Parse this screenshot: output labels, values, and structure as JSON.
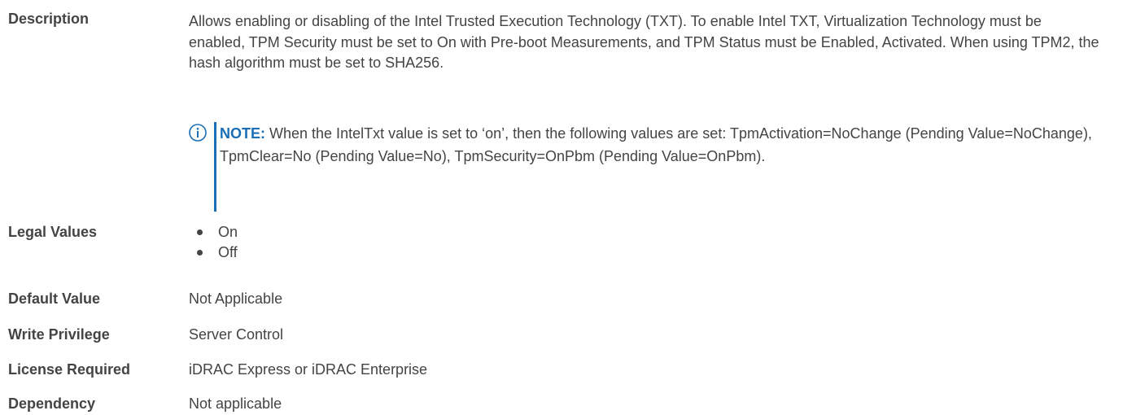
{
  "rows": {
    "description": {
      "label": "Description",
      "text": "Allows enabling or disabling of the Intel Trusted Execution Technology (TXT). To enable Intel TXT, Virtualization Technology must be enabled, TPM Security must be set to On with Pre-boot Measurements, and TPM Status must be Enabled, Activated. When using TPM2, the hash algorithm must be set to SHA256."
    },
    "note": {
      "label": "NOTE:",
      "text": "When the IntelTxt value is set to ‘on’, then the following values are set: TpmActivation=NoChange (Pending Value=NoChange), TpmClear=No (Pending Value=No), TpmSecurity=OnPbm (Pending Value=OnPbm).",
      "icon": "info-circle-icon",
      "accent_color": "#1a6eb5"
    },
    "legal_values": {
      "label": "Legal Values",
      "items": [
        "On",
        "Off"
      ]
    },
    "default_value": {
      "label": "Default Value",
      "value": "Not Applicable"
    },
    "write_privilege": {
      "label": "Write Privilege",
      "value": "Server Control"
    },
    "license_required": {
      "label": "License Required",
      "value": "iDRAC Express or iDRAC Enterprise"
    },
    "dependency": {
      "label": "Dependency",
      "value": "Not applicable"
    }
  }
}
